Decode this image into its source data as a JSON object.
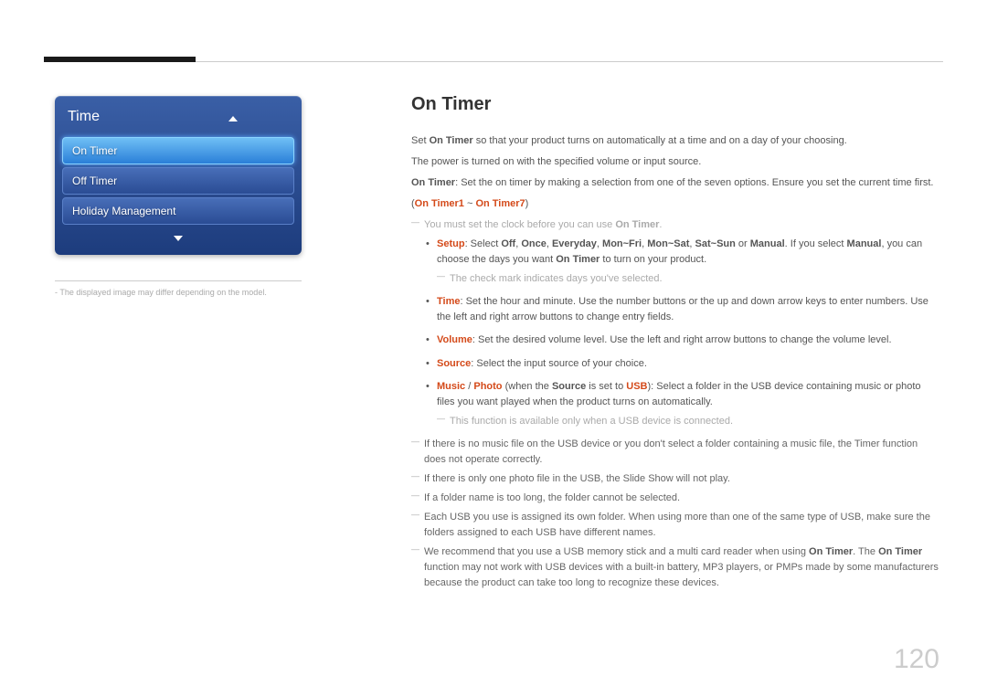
{
  "menu": {
    "title": "Time",
    "items": [
      {
        "label": "On Timer",
        "selected": true
      },
      {
        "label": "Off Timer",
        "selected": false
      },
      {
        "label": "Holiday Management",
        "selected": false
      }
    ]
  },
  "footer_note_prefix": "-  ",
  "footer_note": "The displayed image may differ depending on the model.",
  "section_title": "On Timer",
  "intro1_pre": "Set ",
  "intro1_strong": "On Timer",
  "intro1_post": " so that your product turns on automatically at a time and on a day of your choosing.",
  "intro2": "The power is turned on with the specified volume or input source.",
  "intro3_strong": "On Timer",
  "intro3_post": ": Set the on timer by making a selection from one of the seven options. Ensure you set the current time first.",
  "range_pre": "(",
  "range_a": "On Timer1",
  "range_mid": " ~ ",
  "range_b": "On Timer7",
  "range_post": ")",
  "note_clock_pre": "You must set the clock before you can use ",
  "note_clock_strong": "On Timer",
  "note_clock_post": ".",
  "bullet1": {
    "setup": "Setup",
    "t1": ": Select ",
    "off": "Off",
    "c1": ", ",
    "once": "Once",
    "c2": ", ",
    "everyday": "Everyday",
    "c3": ", ",
    "monfri": "Mon~Fri",
    "c4": ", ",
    "monsat": "Mon~Sat",
    "c5": ", ",
    "satsun": "Sat~Sun",
    "c6": " or ",
    "manual": "Manual",
    "t2": ". If you select ",
    "manual2": "Manual",
    "t3": ", you can choose the days you want ",
    "ontimer": "On Timer",
    "t4": " to turn on your product."
  },
  "note_check": "The check mark indicates days you've selected.",
  "bullet2": {
    "label": "Time",
    "text": ": Set the hour and minute. Use the number buttons or the up and down arrow keys to enter numbers. Use the left and right arrow buttons to change entry fields."
  },
  "bullet3": {
    "label": "Volume",
    "text": ": Set the desired volume level. Use the left and right arrow buttons to change the volume level."
  },
  "bullet4": {
    "label": "Source",
    "text": ": Select the input source of your choice."
  },
  "bullet5": {
    "music": "Music",
    "slash": " / ",
    "photo": "Photo",
    "t1": " (when the ",
    "source": "Source",
    "t2": " is set to ",
    "usb": "USB",
    "t3": "): Select a folder in the USB device containing music or photo files you want played when the product turns on automatically."
  },
  "note_usb": "This function is available only when a USB device is connected.",
  "note_a": "If there is no music file on the USB device or you don't select a folder containing a music file, the Timer function does not operate correctly.",
  "note_b": "If there is only one photo file in the USB, the Slide Show will not play.",
  "note_c": "If a folder name is too long, the folder cannot be selected.",
  "note_d": "Each USB you use is assigned its own folder. When using more than one of the same type of USB, make sure the folders assigned to each USB have different names.",
  "note_e_pre": "We recommend that you use a USB memory stick and a multi card reader when using ",
  "note_e_s1": "On Timer",
  "note_e_mid": ". The ",
  "note_e_s2": "On Timer",
  "note_e_post": " function may not work with USB devices with a built-in battery, MP3 players, or PMPs made by some manufacturers because the product can take too long to recognize these devices.",
  "page_number": "120"
}
